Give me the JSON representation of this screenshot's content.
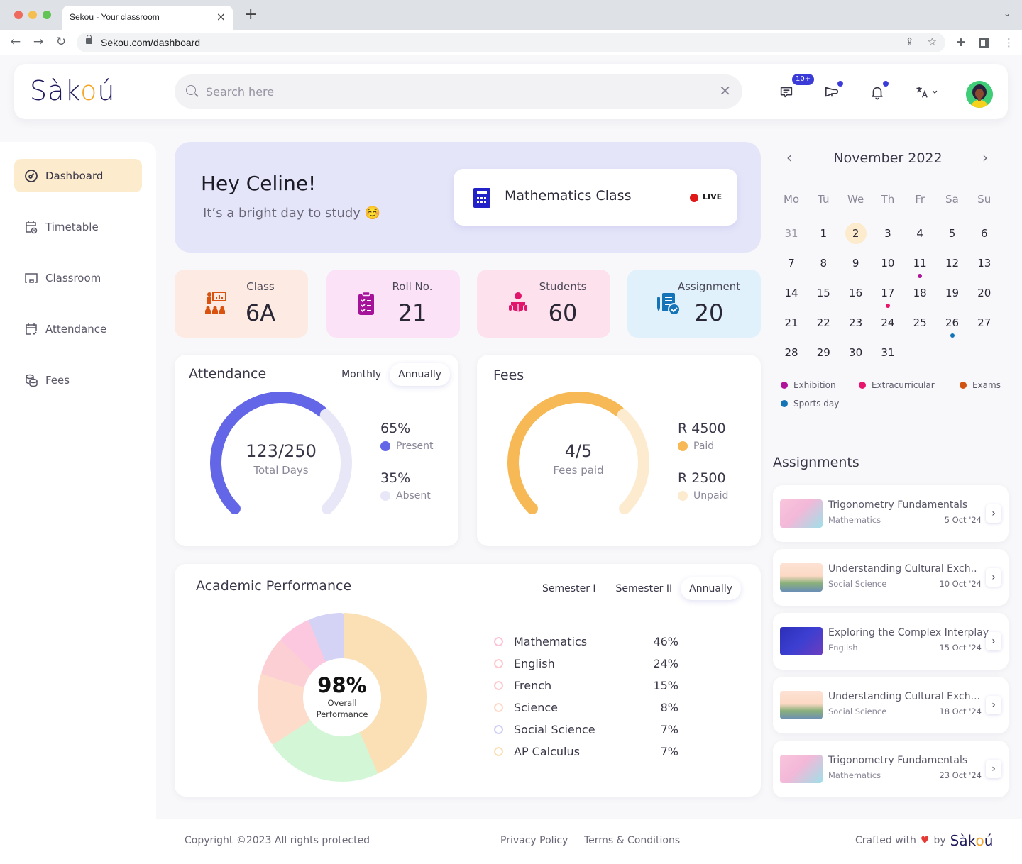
{
  "browser": {
    "tab_title": "Sekou - Your classroom",
    "tab_close": "×",
    "new_tab": "+",
    "url": "Sekou.com/dashboard",
    "traffic_colors": [
      "#ee6a5e",
      "#f5bf4f",
      "#61c454"
    ]
  },
  "header": {
    "logo_prefix": "Sàk",
    "logo_o": "o",
    "logo_suffix": "ú",
    "search_placeholder": "Search here",
    "search_value": "",
    "messages_badge": "10+",
    "icons": [
      "messages-icon",
      "megaphone-icon",
      "bell-icon",
      "translate-icon",
      "avatar"
    ]
  },
  "sidebar": {
    "items": [
      {
        "label": "Dashboard",
        "icon": "dashboard-icon",
        "active": true
      },
      {
        "label": "Timetable",
        "icon": "timetable-icon",
        "active": false
      },
      {
        "label": "Classroom",
        "icon": "classroom-icon",
        "active": false
      },
      {
        "label": "Attendance",
        "icon": "attendance-icon",
        "active": false
      },
      {
        "label": "Fees",
        "icon": "fees-icon",
        "active": false
      }
    ]
  },
  "hero": {
    "greeting": "Hey Celine!",
    "subtitle": "It’s a bright day to study ☺️",
    "live_class": "Mathematics Class",
    "live_label": "LIVE"
  },
  "stats": [
    {
      "label": "Class",
      "value": "6A",
      "bg": "#fdeae2",
      "icon_color": "#d9530f"
    },
    {
      "label": "Roll No.",
      "value": "21",
      "bg": "#fbe2f7",
      "icon_color": "#a5139a"
    },
    {
      "label": "Students",
      "value": "60",
      "bg": "#fde1ec",
      "icon_color": "#e0156b"
    },
    {
      "label": "Assignment",
      "value": "20",
      "bg": "#e1f1fb",
      "icon_color": "#1574b8"
    }
  ],
  "attendance": {
    "title": "Attendance",
    "tabs": [
      "Monthly",
      "Annually"
    ],
    "active_tab": "Annually",
    "center_value": "123/250",
    "center_label": "Total Days",
    "present_pct": "65%",
    "present_label": "Present",
    "absent_pct": "35%",
    "absent_label": "Absent",
    "present_fraction": 0.65,
    "colors": {
      "present": "#6366e6",
      "absent": "#e7e7f8"
    }
  },
  "fees": {
    "title": "Fees",
    "center_value": "4/5",
    "center_label": "Fees paid",
    "paid_amount": "R 4500",
    "paid_label": "Paid",
    "unpaid_amount": "R 2500",
    "unpaid_label": "Unpaid",
    "paid_fraction": 0.65,
    "colors": {
      "paid": "#f7b955",
      "unpaid": "#fdebcf"
    }
  },
  "performance": {
    "title": "Academic Performance",
    "tabs": [
      "Semester I",
      "Semester II",
      "Annually"
    ],
    "active_tab": "Annually",
    "overall_value": "98%",
    "overall_label_1": "Overall",
    "overall_label_2": "Performance"
  },
  "chart_data": {
    "type": "pie",
    "title": "Academic Performance",
    "center_text": "98% Overall Performance",
    "categories": [
      "Mathematics",
      "English",
      "French",
      "Science",
      "Social Science",
      "AP Calculus"
    ],
    "values": [
      46,
      24,
      15,
      8,
      7,
      7
    ],
    "labels": [
      "46%",
      "24%",
      "15%",
      "8%",
      "7%",
      "7%"
    ],
    "ring_colors": [
      "#fcc5da",
      "#fccbd0",
      "#fccbd0",
      "#fdd9c8",
      "#d0d0f6",
      "#fbe0b5"
    ],
    "slice_colors": [
      "#fbe0b5",
      "#d3f7d6",
      "#fddccc",
      "#fccfd4",
      "#fcc8e0",
      "#d4d3f6"
    ],
    "legend_position": "right"
  },
  "calendar": {
    "month_label": "November 2022",
    "prev": "‹",
    "next": "›",
    "weekdays": [
      "Mo",
      "Tu",
      "We",
      "Th",
      "Fr",
      "Sa",
      "Su"
    ],
    "weeks": [
      [
        "31",
        "1",
        "2",
        "3",
        "4",
        "5",
        "6"
      ],
      [
        "7",
        "8",
        "9",
        "10",
        "11",
        "12",
        "13"
      ],
      [
        "14",
        "15",
        "16",
        "17",
        "18",
        "19",
        "20"
      ],
      [
        "21",
        "22",
        "23",
        "24",
        "25",
        "26",
        "27"
      ],
      [
        "28",
        "29",
        "30",
        "31",
        "",
        "",
        ""
      ]
    ],
    "today": "2",
    "events": [
      {
        "day": "11",
        "type": "Exhibition"
      },
      {
        "day": "17",
        "type": "Extracurricular"
      },
      {
        "day": "26",
        "type": "Sports day"
      }
    ],
    "legend": [
      {
        "label": "Exhibition",
        "color": "#b0139a"
      },
      {
        "label": "Extracurricular",
        "color": "#e8156c"
      },
      {
        "label": "Exams",
        "color": "#d2520f"
      },
      {
        "label": "Sports day",
        "color": "#1574b8"
      }
    ]
  },
  "assignments": {
    "title": "Assignments",
    "items": [
      {
        "title": "Trigonometry Fundamentals",
        "subject": "Mathematics",
        "date": "5 Oct '24",
        "thumb": "math"
      },
      {
        "title": "Understanding Cultural Exch..",
        "subject": "Social Science",
        "date": "10 Oct '24",
        "thumb": "social"
      },
      {
        "title": "Exploring the Complex Interplay",
        "subject": "English",
        "date": "15 Oct '24",
        "thumb": "english"
      },
      {
        "title": "Understanding Cultural Exch...",
        "subject": "Social Science",
        "date": "18 Oct '24",
        "thumb": "social"
      },
      {
        "title": "Trigonometry Fundamentals",
        "subject": "Mathematics",
        "date": "23 Oct '24",
        "thumb": "math"
      }
    ]
  },
  "footer": {
    "copyright": "Copyright ©2023 All rights protected",
    "privacy": "Privacy Policy",
    "terms": "Terms & Conditions",
    "crafted": "Crafted with",
    "heart": "❤️",
    "by": "by"
  }
}
